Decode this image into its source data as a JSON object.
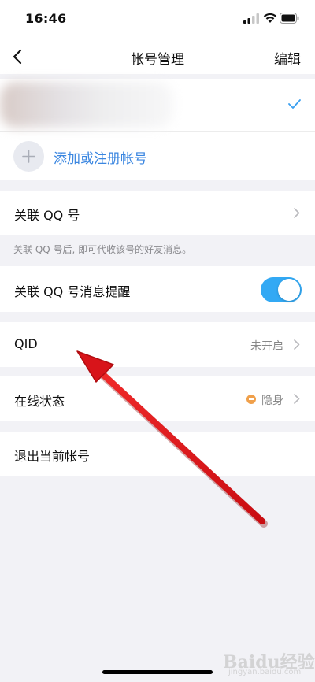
{
  "status_bar": {
    "time": "16:46"
  },
  "nav": {
    "title": "帐号管理",
    "edit_label": "编辑"
  },
  "account": {
    "add_label": "添加或注册帐号"
  },
  "rows": {
    "link_qq": {
      "label": "关联 QQ 号",
      "hint": "关联 QQ 号后, 即可代收该号的好友消息。"
    },
    "link_qq_notify": {
      "label": "关联 QQ 号消息提醒",
      "enabled": true
    },
    "qid": {
      "label": "QID",
      "value": "未开启"
    },
    "online_status": {
      "label": "在线状态",
      "value": "隐身"
    },
    "logout": {
      "label": "退出当前帐号"
    }
  },
  "watermark": {
    "text": "Baidu经验",
    "sub": "jingyan.baidu.com"
  },
  "colors": {
    "accent": "#3a86e0",
    "toggle": "#33a9f4",
    "arrow": "#e0161a",
    "status_dot": "#f0a04b"
  }
}
